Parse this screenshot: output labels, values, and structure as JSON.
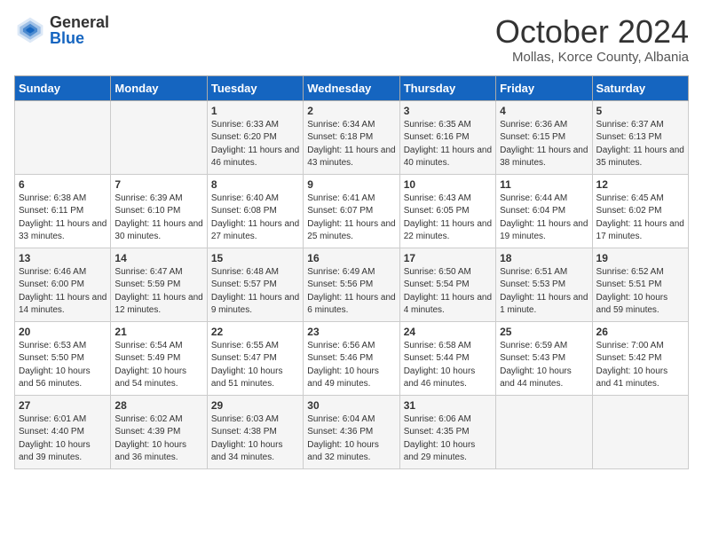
{
  "header": {
    "logo_general": "General",
    "logo_blue": "Blue",
    "month_title": "October 2024",
    "location": "Mollas, Korce County, Albania"
  },
  "weekdays": [
    "Sunday",
    "Monday",
    "Tuesday",
    "Wednesday",
    "Thursday",
    "Friday",
    "Saturday"
  ],
  "weeks": [
    [
      {
        "day": "",
        "content": ""
      },
      {
        "day": "",
        "content": ""
      },
      {
        "day": "1",
        "content": "Sunrise: 6:33 AM\nSunset: 6:20 PM\nDaylight: 11 hours and 46 minutes."
      },
      {
        "day": "2",
        "content": "Sunrise: 6:34 AM\nSunset: 6:18 PM\nDaylight: 11 hours and 43 minutes."
      },
      {
        "day": "3",
        "content": "Sunrise: 6:35 AM\nSunset: 6:16 PM\nDaylight: 11 hours and 40 minutes."
      },
      {
        "day": "4",
        "content": "Sunrise: 6:36 AM\nSunset: 6:15 PM\nDaylight: 11 hours and 38 minutes."
      },
      {
        "day": "5",
        "content": "Sunrise: 6:37 AM\nSunset: 6:13 PM\nDaylight: 11 hours and 35 minutes."
      }
    ],
    [
      {
        "day": "6",
        "content": "Sunrise: 6:38 AM\nSunset: 6:11 PM\nDaylight: 11 hours and 33 minutes."
      },
      {
        "day": "7",
        "content": "Sunrise: 6:39 AM\nSunset: 6:10 PM\nDaylight: 11 hours and 30 minutes."
      },
      {
        "day": "8",
        "content": "Sunrise: 6:40 AM\nSunset: 6:08 PM\nDaylight: 11 hours and 27 minutes."
      },
      {
        "day": "9",
        "content": "Sunrise: 6:41 AM\nSunset: 6:07 PM\nDaylight: 11 hours and 25 minutes."
      },
      {
        "day": "10",
        "content": "Sunrise: 6:43 AM\nSunset: 6:05 PM\nDaylight: 11 hours and 22 minutes."
      },
      {
        "day": "11",
        "content": "Sunrise: 6:44 AM\nSunset: 6:04 PM\nDaylight: 11 hours and 19 minutes."
      },
      {
        "day": "12",
        "content": "Sunrise: 6:45 AM\nSunset: 6:02 PM\nDaylight: 11 hours and 17 minutes."
      }
    ],
    [
      {
        "day": "13",
        "content": "Sunrise: 6:46 AM\nSunset: 6:00 PM\nDaylight: 11 hours and 14 minutes."
      },
      {
        "day": "14",
        "content": "Sunrise: 6:47 AM\nSunset: 5:59 PM\nDaylight: 11 hours and 12 minutes."
      },
      {
        "day": "15",
        "content": "Sunrise: 6:48 AM\nSunset: 5:57 PM\nDaylight: 11 hours and 9 minutes."
      },
      {
        "day": "16",
        "content": "Sunrise: 6:49 AM\nSunset: 5:56 PM\nDaylight: 11 hours and 6 minutes."
      },
      {
        "day": "17",
        "content": "Sunrise: 6:50 AM\nSunset: 5:54 PM\nDaylight: 11 hours and 4 minutes."
      },
      {
        "day": "18",
        "content": "Sunrise: 6:51 AM\nSunset: 5:53 PM\nDaylight: 11 hours and 1 minute."
      },
      {
        "day": "19",
        "content": "Sunrise: 6:52 AM\nSunset: 5:51 PM\nDaylight: 10 hours and 59 minutes."
      }
    ],
    [
      {
        "day": "20",
        "content": "Sunrise: 6:53 AM\nSunset: 5:50 PM\nDaylight: 10 hours and 56 minutes."
      },
      {
        "day": "21",
        "content": "Sunrise: 6:54 AM\nSunset: 5:49 PM\nDaylight: 10 hours and 54 minutes."
      },
      {
        "day": "22",
        "content": "Sunrise: 6:55 AM\nSunset: 5:47 PM\nDaylight: 10 hours and 51 minutes."
      },
      {
        "day": "23",
        "content": "Sunrise: 6:56 AM\nSunset: 5:46 PM\nDaylight: 10 hours and 49 minutes."
      },
      {
        "day": "24",
        "content": "Sunrise: 6:58 AM\nSunset: 5:44 PM\nDaylight: 10 hours and 46 minutes."
      },
      {
        "day": "25",
        "content": "Sunrise: 6:59 AM\nSunset: 5:43 PM\nDaylight: 10 hours and 44 minutes."
      },
      {
        "day": "26",
        "content": "Sunrise: 7:00 AM\nSunset: 5:42 PM\nDaylight: 10 hours and 41 minutes."
      }
    ],
    [
      {
        "day": "27",
        "content": "Sunrise: 6:01 AM\nSunset: 4:40 PM\nDaylight: 10 hours and 39 minutes."
      },
      {
        "day": "28",
        "content": "Sunrise: 6:02 AM\nSunset: 4:39 PM\nDaylight: 10 hours and 36 minutes."
      },
      {
        "day": "29",
        "content": "Sunrise: 6:03 AM\nSunset: 4:38 PM\nDaylight: 10 hours and 34 minutes."
      },
      {
        "day": "30",
        "content": "Sunrise: 6:04 AM\nSunset: 4:36 PM\nDaylight: 10 hours and 32 minutes."
      },
      {
        "day": "31",
        "content": "Sunrise: 6:06 AM\nSunset: 4:35 PM\nDaylight: 10 hours and 29 minutes."
      },
      {
        "day": "",
        "content": ""
      },
      {
        "day": "",
        "content": ""
      }
    ]
  ]
}
